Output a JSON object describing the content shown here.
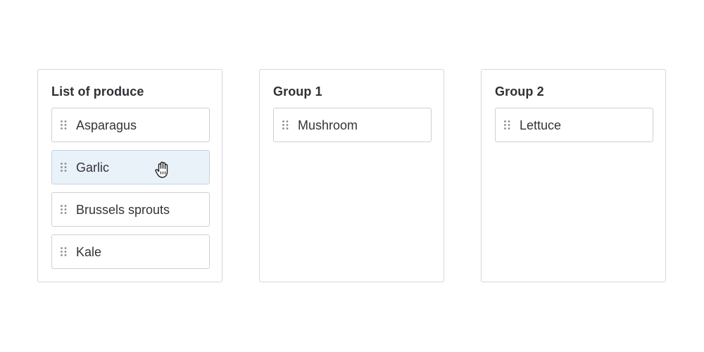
{
  "columns": [
    {
      "title": "List of produce",
      "items": [
        {
          "label": "Asparagus",
          "icon": "drag-handle-icon"
        },
        {
          "label": "Garlic",
          "icon": "drag-handle-icon",
          "state": "being-dragged"
        },
        {
          "label": "Brussels sprouts",
          "icon": "drag-handle-icon"
        },
        {
          "label": "Kale",
          "icon": "drag-handle-icon"
        }
      ]
    },
    {
      "title": "Group 1",
      "items": [
        {
          "label": "Mushroom",
          "icon": "drag-handle-icon"
        }
      ]
    },
    {
      "title": "Group 2",
      "items": [
        {
          "label": "Lettuce",
          "icon": "drag-handle-icon"
        }
      ]
    }
  ],
  "cursor": {
    "icon": "grab-hand-cursor-icon"
  },
  "colors": {
    "border": "#d6d6d9",
    "item_border": "#cfd0d4",
    "dragging_background": "#eaf2f9",
    "text": "#333338",
    "handle": "#8a8a90"
  }
}
